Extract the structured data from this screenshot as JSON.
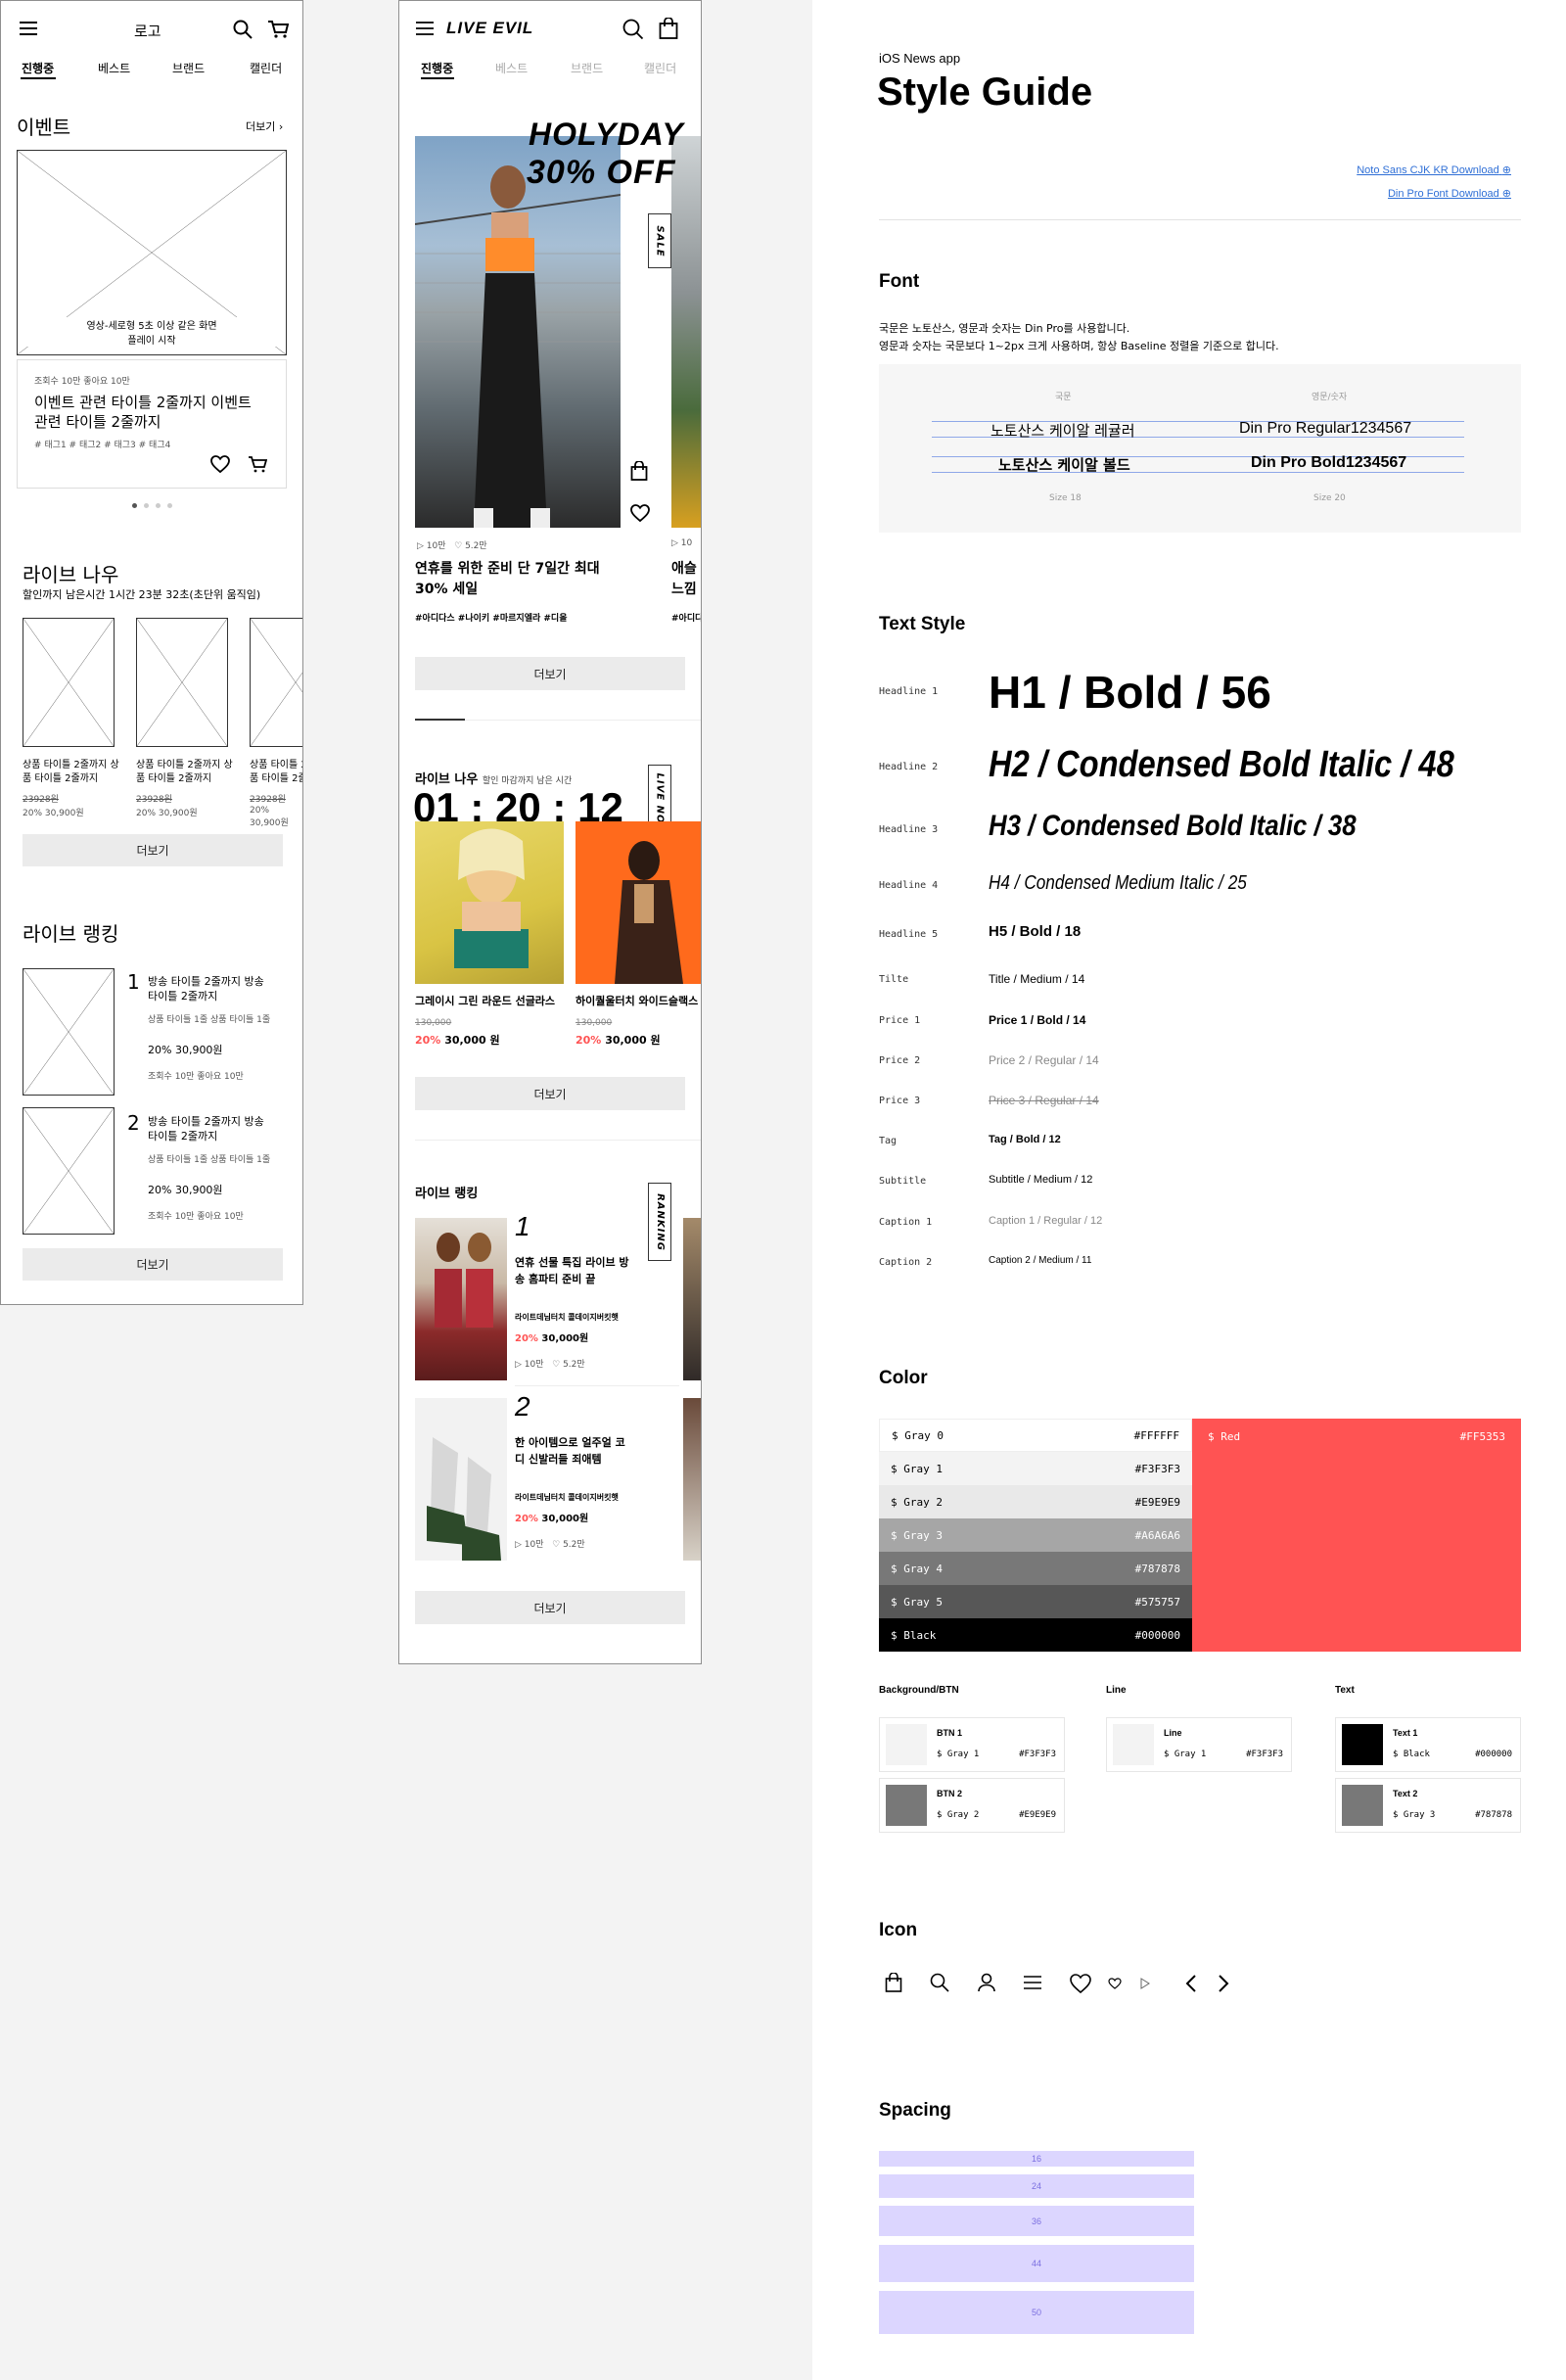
{
  "wireframe": {
    "header": {
      "logo": "로고"
    },
    "tabs": [
      "진행중",
      "베스트",
      "브랜드",
      "캘린더"
    ],
    "event_section": {
      "title": "이벤트",
      "more": "더보기",
      "video_placeholder": "영상-세로형 5초 이상 같은 화면\n플레이 시작",
      "stats": "조회수 10만    좋아요 10만",
      "event_title": "이벤트 관련 타이틀 2줄까지 이벤트 관련 타이틀 2줄까지",
      "tags": "# 태그1  # 태그2  # 태그3  # 태그4"
    },
    "live_now": {
      "title": "라이브 나우",
      "subtitle": "할인까지 남은시간 1시간 23분 32초(초단위 움직임)",
      "products": [
        {
          "title": "상품 타이틀 2줄까지 상품 타이틀 2줄까지",
          "orig": "23928원",
          "price": "20% 30,900원"
        },
        {
          "title": "상품 타이틀 2줄까지 상품 타이틀 2줄까지",
          "orig": "23928원",
          "price": "20% 30,900원"
        },
        {
          "title": "상품 타이틀 2줄까지 상품 타이틀 2줄까지",
          "orig": "23928원",
          "price": "20% 30,900원"
        }
      ],
      "more": "더보기"
    },
    "live_ranking": {
      "title": "라이브 랭킹",
      "items": [
        {
          "rank": "1",
          "title": "방송 타이틀 2줄까지 방송 타이틀 2줄까지",
          "sub": "상품 타이틀 1줄 상품 타이틀 1줄",
          "price": "20% 30,900원",
          "stats": "조회수 10만    좋아요 10만"
        },
        {
          "rank": "2",
          "title": "방송 타이틀 2줄까지 방송 타이틀 2줄까지",
          "sub": "상품 타이틀 1줄 상품 타이틀 1줄",
          "price": "20% 30,900원",
          "stats": "조회수 10만    좋아요 10만"
        }
      ],
      "more": "더보기"
    }
  },
  "mockup": {
    "header": {
      "logo": "LIVE EVIL"
    },
    "tabs": [
      "진행중",
      "베스트",
      "브랜드",
      "캘린더"
    ],
    "hero": {
      "banner_line1": "HOLYDAY",
      "banner_line2": "30% OFF",
      "side_tag": "SALE",
      "views": "10만",
      "likes": "5.2만",
      "title": "연휴를 위한 준비 단 7일간 최대 30% 세일",
      "tags": "#아디다스  #나이키  #마르지엘라  #디올",
      "next_title": "애슬 느낌",
      "next_tags": "#아디다",
      "next_views": "10"
    },
    "hero_more": "더보기",
    "live_now": {
      "title": "라이브 나우",
      "sub": "할인 마감까지 남은 시간",
      "timer": "01 : 20 : 12",
      "side_tag": "LIVE NOW",
      "products": [
        {
          "name": "그레이시 그린 라운드 선글라스",
          "orig": "130,000",
          "pct": "20%",
          "price": "30,000 원"
        },
        {
          "name": "하이퀄울터치 와이드슬랙스",
          "orig": "130,000",
          "pct": "20%",
          "price": "30,000 원"
        }
      ],
      "more": "더보기"
    },
    "ranking": {
      "title": "라이브 랭킹",
      "side_tag": "RANKING",
      "items": [
        {
          "rank": "1",
          "title": "연휴 선물 특집 라이브 방송 홈파티 준비 끝",
          "brand": "라이트데님터치 콜데이지버킷햇",
          "pct": "20%",
          "price": "30,000원",
          "views": "10만",
          "likes": "5.2만"
        },
        {
          "rank": "2",
          "title": "한 아이템으로 얼주얼 코디 신발러들 죄애템",
          "brand": "라이트데님터치 콜데이지버킷햇",
          "pct": "20%",
          "price": "30,000원",
          "views": "10만",
          "likes": "5.2만"
        }
      ],
      "more": "더보기"
    }
  },
  "style_guide": {
    "kicker": "iOS News app",
    "title": "Style Guide",
    "links": [
      "Noto Sans CJK KR Download",
      "Din Pro Font Download"
    ],
    "font": {
      "heading": "Font",
      "desc1": "국문은 노토산스, 영문과 숫자는 Din Pro를 사용합니다.",
      "desc2": "영문과 숫자는 국문보다 1~2px 크게 사용하며, 항상 Baseline 정렬을 기준으로 합니다.",
      "col_ko": "국문",
      "col_en": "영문/숫자",
      "ko_regular": "노토산스 케이알 레귤러",
      "en_regular": "Din Pro Regular1234567",
      "ko_bold": "노토산스 케이알 볼드",
      "en_bold": "Din Pro Bold1234567",
      "size_ko": "Size 18",
      "size_en": "Size 20"
    },
    "text_style": {
      "heading": "Text Style",
      "rows": [
        {
          "label": "Headline 1",
          "sample": "H1 / Bold / 56"
        },
        {
          "label": "Headline 2",
          "sample": "H2 / Condensed Bold Italic / 48"
        },
        {
          "label": "Headline 3",
          "sample": "H3 / Condensed Bold Italic / 38"
        },
        {
          "label": "Headline 4",
          "sample": "H4 / Condensed Medium Italic / 25"
        },
        {
          "label": "Headline 5",
          "sample": "H5 / Bold / 18"
        },
        {
          "label": "Tilte",
          "sample": "Title / Medium / 14"
        },
        {
          "label": "Price 1",
          "sample": "Price 1 / Bold / 14"
        },
        {
          "label": "Price 2",
          "sample": "Price 2 / Regular / 14"
        },
        {
          "label": "Price 3",
          "sample": "Price 3 / Regular / 14"
        },
        {
          "label": "Tag",
          "sample": "Tag / Bold / 12"
        },
        {
          "label": "Subtitle",
          "sample": "Subtitle / Medium / 12"
        },
        {
          "label": "Caption 1",
          "sample": "Caption 1 / Regular / 12"
        },
        {
          "label": "Caption 2",
          "sample": "Caption 2 / Medium / 11"
        }
      ]
    },
    "color": {
      "heading": "Color",
      "grays": [
        {
          "name": "$ Gray 0",
          "hex": "#FFFFFF"
        },
        {
          "name": "$ Gray 1",
          "hex": "#F3F3F3"
        },
        {
          "name": "$ Gray 2",
          "hex": "#E9E9E9"
        },
        {
          "name": "$ Gray 3",
          "hex": "#A6A6A6"
        },
        {
          "name": "$ Gray 4",
          "hex": "#787878"
        },
        {
          "name": "$ Gray 5",
          "hex": "#575757"
        },
        {
          "name": "$ Black",
          "hex": "#000000"
        }
      ],
      "red": {
        "name": "$ Red",
        "hex": "#FF5353"
      },
      "groups": {
        "bg": "Background/BTN",
        "line": "Line",
        "text": "Text"
      },
      "cards": [
        {
          "title": "BTN 1",
          "name": "$ Gray 1",
          "hex": "#F3F3F3",
          "swatch": "#F3F3F3"
        },
        {
          "title": "BTN 2",
          "name": "$ Gray 2",
          "hex": "#E9E9E9",
          "swatch": "#787878"
        },
        {
          "title": "Line",
          "name": "$ Gray 1",
          "hex": "#F3F3F3",
          "swatch": "#F3F3F3"
        },
        {
          "title": "Text 1",
          "name": "$ Black",
          "hex": "#000000",
          "swatch": "#000000"
        },
        {
          "title": "Text 2",
          "name": "$ Gray 3",
          "hex": "#787878",
          "swatch": "#787878"
        }
      ]
    },
    "icon": {
      "heading": "Icon",
      "icons": [
        "bag-icon",
        "search-icon",
        "user-icon",
        "menu-icon",
        "heart-icon",
        "heart-small-icon",
        "play-icon",
        "chevron-left-icon",
        "chevron-right-icon"
      ]
    },
    "spacing": {
      "heading": "Spacing",
      "values": [
        "16",
        "24",
        "36",
        "44",
        "50"
      ]
    }
  }
}
